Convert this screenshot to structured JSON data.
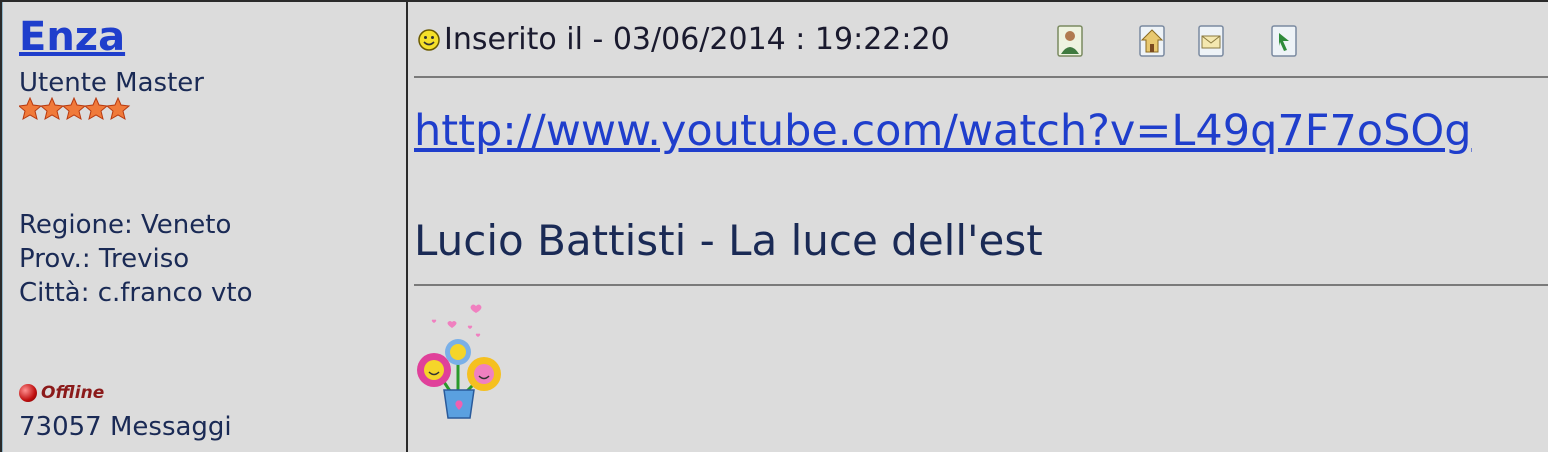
{
  "author": {
    "name": "Enza",
    "rank": "Utente Master",
    "stars": 5,
    "region": "Regione: Veneto",
    "province": "Prov.: Treviso",
    "city": "Città: c.franco vto",
    "status": "Offline",
    "posts": "73057 Messaggi"
  },
  "post": {
    "posted_label": "Inserito il -  03/06/2014 :  19:22:20",
    "link": "http://www.youtube.com/watch?v=L49q7F7oSOg",
    "title": "Lucio Battisti - La luce dell'est"
  },
  "actions": [
    {
      "name": "profile-icon"
    },
    {
      "name": "homepage-icon"
    },
    {
      "name": "email-icon"
    },
    {
      "name": "quote-icon"
    }
  ],
  "colors": {
    "background": "#dcdcdc",
    "link": "#1f3ecc",
    "text": "#1a2a55"
  }
}
